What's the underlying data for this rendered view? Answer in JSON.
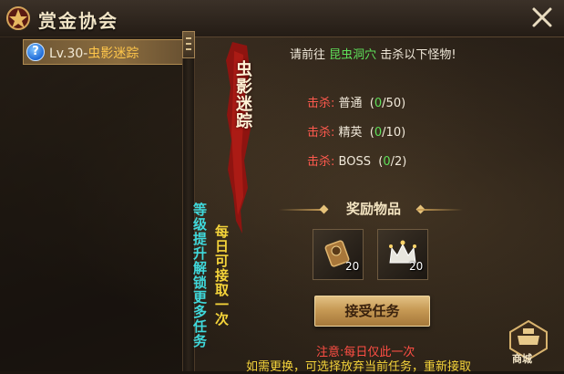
{
  "window": {
    "title": "赏金协会"
  },
  "quest_list": {
    "items": [
      {
        "level": "Lv.30-",
        "name": "虫影迷踪",
        "icon": "question-icon",
        "icon_text": "?"
      }
    ]
  },
  "side_notes": {
    "left": "等级提升解锁更多任务",
    "right": "每日可接取一次"
  },
  "quest": {
    "banner": "虫影迷踪",
    "goal_prefix": "请前往",
    "goal_location": "昆虫洞穴",
    "goal_suffix": "击杀以下怪物!",
    "kills": [
      {
        "label": "击杀:",
        "target": "普通",
        "current": "0",
        "total": "/50)"
      },
      {
        "label": "击杀:",
        "target": "精英",
        "current": "0",
        "total": "/10)"
      },
      {
        "label": "击杀:",
        "target": "BOSS",
        "current": "0",
        "total": "/2)"
      }
    ]
  },
  "rewards": {
    "title": "奖励物品",
    "items": [
      {
        "icon": "reward-scroll-icon",
        "count": "20"
      },
      {
        "icon": "crown-icon",
        "count": "20"
      }
    ]
  },
  "accept_button": "接受任务",
  "shop": {
    "label": "商城",
    "icon": "shop-icon"
  },
  "note": "注意:每日仅此一次",
  "hint": "如需更换，可选择放弃当前任务，重新接取",
  "colors": {
    "accent_gold": "#c89d55",
    "location_green": "#5fe05a",
    "kill_red": "#ff5a4e",
    "note_yellow": "#f4d33a",
    "info_cyan": "#3fd9dc"
  }
}
